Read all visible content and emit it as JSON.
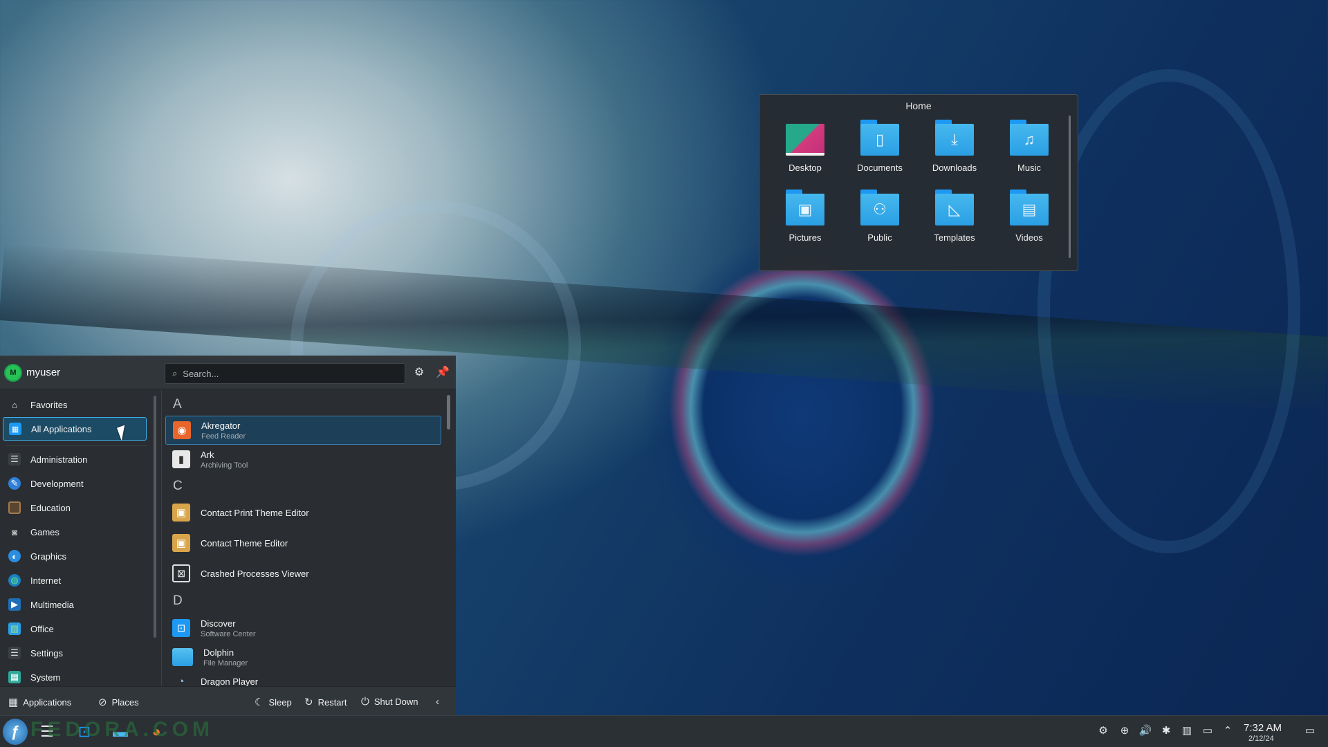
{
  "home_popup": {
    "title": "Home",
    "folders": [
      {
        "label": "Desktop",
        "icon": "desktop-icon",
        "glyph": ""
      },
      {
        "label": "Documents",
        "icon": "document-icon",
        "glyph": "▯"
      },
      {
        "label": "Downloads",
        "icon": "download-icon",
        "glyph": "⤓"
      },
      {
        "label": "Music",
        "icon": "music-icon",
        "glyph": "♫"
      },
      {
        "label": "Pictures",
        "icon": "picture-icon",
        "glyph": "▣"
      },
      {
        "label": "Public",
        "icon": "people-icon",
        "glyph": "⚇"
      },
      {
        "label": "Templates",
        "icon": "template-icon",
        "glyph": "◺"
      },
      {
        "label": "Videos",
        "icon": "film-icon",
        "glyph": "▤"
      }
    ]
  },
  "launcher": {
    "user": {
      "initial": "M",
      "name": "myuser"
    },
    "search": {
      "placeholder": "Search..."
    },
    "categories": [
      {
        "label": "Favorites",
        "icon": "bookmark-icon",
        "glyph": "🔖"
      },
      {
        "label": "All Applications",
        "icon": "grid-icon",
        "glyph": "▦"
      },
      {
        "label": "Administration",
        "icon": "admin-icon",
        "glyph": "▤"
      },
      {
        "label": "Development",
        "icon": "development-icon",
        "glyph": "✎"
      },
      {
        "label": "Education",
        "icon": "education-icon",
        "glyph": "▭"
      },
      {
        "label": "Games",
        "icon": "gamepad-icon",
        "glyph": "🎮"
      },
      {
        "label": "Graphics",
        "icon": "graphics-icon",
        "glyph": "◐"
      },
      {
        "label": "Internet",
        "icon": "globe-icon",
        "glyph": "🌐"
      },
      {
        "label": "Multimedia",
        "icon": "multimedia-icon",
        "glyph": "▶"
      },
      {
        "label": "Office",
        "icon": "office-icon",
        "glyph": "▥"
      },
      {
        "label": "Settings",
        "icon": "settings-icon",
        "glyph": "☰"
      },
      {
        "label": "System",
        "icon": "system-icon",
        "glyph": "▦"
      }
    ],
    "sections": [
      {
        "letter": "A"
      },
      {
        "letter": "C"
      },
      {
        "letter": "D"
      }
    ],
    "apps": [
      {
        "name": "Akregator",
        "desc": "Feed Reader",
        "icon": "rss-icon",
        "glyph": "◉"
      },
      {
        "name": "Ark",
        "desc": "Archiving Tool",
        "icon": "archive-icon",
        "glyph": "▮"
      },
      {
        "name": "Contact Print Theme Editor",
        "desc": "",
        "icon": "theme-editor-icon",
        "glyph": "▣"
      },
      {
        "name": "Contact Theme Editor",
        "desc": "",
        "icon": "theme-editor-icon",
        "glyph": "▣"
      },
      {
        "name": "Crashed Processes Viewer",
        "desc": "",
        "icon": "crash-viewer-icon",
        "glyph": "⊠"
      },
      {
        "name": "Discover",
        "desc": "Software Center",
        "icon": "store-icon",
        "glyph": "🛍"
      },
      {
        "name": "Dolphin",
        "desc": "File Manager",
        "icon": "folder-icon",
        "glyph": "▬"
      },
      {
        "name": "Dragon Player",
        "desc": "",
        "icon": "dragon-icon",
        "glyph": "◔"
      }
    ],
    "footer": {
      "applications": "Applications",
      "places": "Places",
      "sleep": "Sleep",
      "restart": "Restart",
      "shutdown": "Shut Down"
    }
  },
  "taskbar": {
    "clock": {
      "time": "7:32 AM",
      "date": "2/12/24"
    },
    "watermark": "FEDORA.COM"
  },
  "colors": {
    "accent": "#3daee9",
    "panel": "#2a2e32",
    "folder": "#2a9fe4"
  }
}
